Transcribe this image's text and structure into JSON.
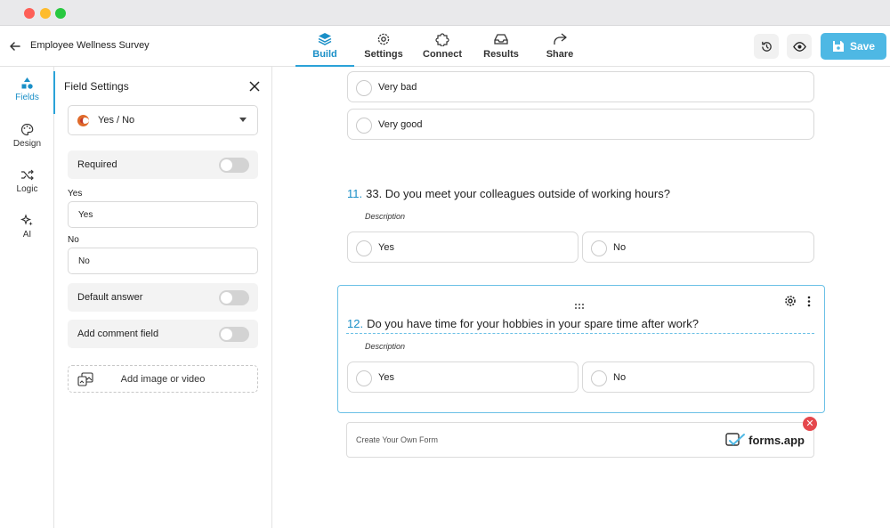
{
  "window": {
    "title": ""
  },
  "header": {
    "form_title": "Employee Wellness Survey",
    "tabs": [
      {
        "label": "Build",
        "icon": "layers-icon",
        "active": true
      },
      {
        "label": "Settings",
        "icon": "gear-icon",
        "active": false
      },
      {
        "label": "Connect",
        "icon": "puzzle-icon",
        "active": false
      },
      {
        "label": "Results",
        "icon": "inbox-icon",
        "active": false
      },
      {
        "label": "Share",
        "icon": "share-arrow-icon",
        "active": false
      }
    ],
    "save_label": "Save"
  },
  "sidebar": {
    "items": [
      {
        "label": "Fields",
        "icon": "shapes-icon",
        "active": true
      },
      {
        "label": "Design",
        "icon": "palette-icon",
        "active": false
      },
      {
        "label": "Logic",
        "icon": "shuffle-icon",
        "active": false
      },
      {
        "label": "AI",
        "icon": "sparkles-icon",
        "active": false
      }
    ]
  },
  "field_settings": {
    "title": "Field Settings",
    "field_type": "Yes / No",
    "required_label": "Required",
    "required": false,
    "yes_label": "Yes",
    "yes_value": "Yes",
    "no_label": "No",
    "no_value": "No",
    "default_answer_label": "Default answer",
    "default_answer": false,
    "comment_field_label": "Add comment field",
    "comment_field": false,
    "media_button_label": "Add image or video"
  },
  "form": {
    "prev_options": [
      "Very bad",
      "Very good"
    ],
    "questions": [
      {
        "number": "11.",
        "title": "33. Do you meet your colleagues outside of working hours?",
        "description": "Description",
        "options": [
          "Yes",
          "No"
        ]
      },
      {
        "number": "12.",
        "title": "Do you have time for your hobbies in your spare time after work?",
        "description": "Description",
        "options": [
          "Yes",
          "No"
        ],
        "selected": true
      }
    ],
    "branding": {
      "cta": "Create Your Own Form",
      "logo_text": "forms.app"
    }
  },
  "colors": {
    "accent": "#2aa2d8",
    "save_button": "#4eb8e4",
    "remove_badge": "#e5484d"
  }
}
